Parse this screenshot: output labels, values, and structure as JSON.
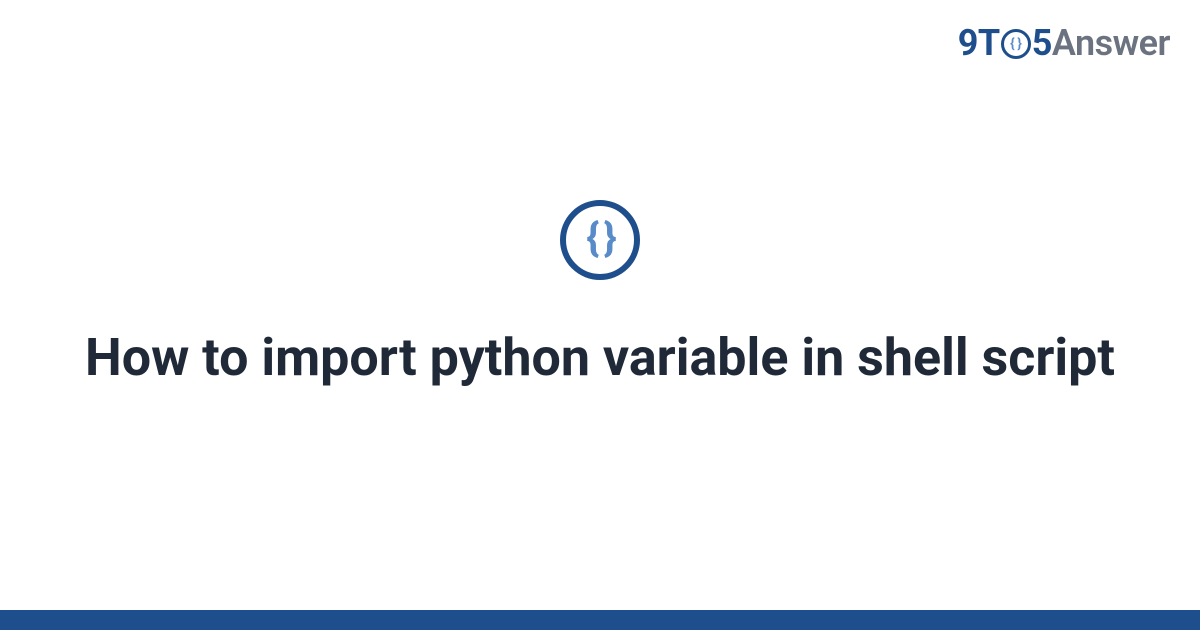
{
  "logo": {
    "part1": "9",
    "part2": "T",
    "icon_inner": "{ }",
    "part3": "5",
    "part4": "Answer"
  },
  "badge": {
    "icon_text": "{ }"
  },
  "title": "How to import python variable in shell script",
  "colors": {
    "primary": "#1e4e8c",
    "accent": "#5a8bc9",
    "text": "#1f2937",
    "muted": "#6b7280"
  }
}
